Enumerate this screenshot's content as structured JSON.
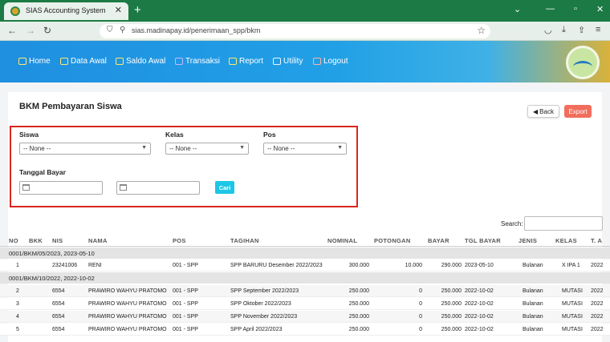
{
  "browser": {
    "tab_title": "SIAS Accounting System",
    "url": "sias.madinapay.id/penerimaan_spp/bkm"
  },
  "nav": {
    "items": [
      {
        "label": "Home",
        "icon": "home-icon"
      },
      {
        "label": "Data Awal",
        "icon": "monitor-icon"
      },
      {
        "label": "Saldo Awal",
        "icon": "scale-icon"
      },
      {
        "label": "Transaksi",
        "icon": "cart-icon"
      },
      {
        "label": "Report",
        "icon": "monitor-icon"
      },
      {
        "label": "Utility",
        "icon": "tools-icon"
      },
      {
        "label": "Logout",
        "icon": "logout-icon"
      }
    ]
  },
  "page": {
    "title": "BKM Pembayaran Siswa",
    "back_label": "Back",
    "export_label": "Export"
  },
  "filters": {
    "siswa_label": "Siswa",
    "siswa_value": "-- None --",
    "kelas_label": "Kelas",
    "kelas_value": "-- None --",
    "pos_label": "Pos",
    "pos_value": "-- None --",
    "tanggal_label": "Tanggal Bayar",
    "cari_label": "Cari"
  },
  "search": {
    "label": "Search:"
  },
  "table": {
    "headers": [
      "NO",
      "BKK",
      "NIS",
      "NAMA",
      "POS",
      "TAGIHAN",
      "NOMINAL",
      "POTONGAN",
      "BAYAR",
      "TGL BAYAR",
      "JENIS",
      "KELAS",
      "T. A"
    ],
    "groups": [
      {
        "label": "0001/BKM/05/2023, 2023-05-10",
        "rows": [
          [
            "1",
            "",
            "23241006",
            "RENI",
            "001 - SPP",
            "SPP BARURU Desember 2022/2023",
            "300.000",
            "10.000",
            "290.000",
            "2023-05-10",
            "Bulanan",
            "X IPA 1",
            "2022"
          ]
        ]
      },
      {
        "label": "0001/BKM/10/2022, 2022-10-02",
        "rows": [
          [
            "2",
            "",
            "6554",
            "PRAWIRO WAHYU PRATOMO",
            "001 - SPP",
            "SPP September 2022/2023",
            "250.000",
            "0",
            "250.000",
            "2022-10-02",
            "Bulanan",
            "MUTASI",
            "2022"
          ],
          [
            "3",
            "",
            "6554",
            "PRAWIRO WAHYU PRATOMO",
            "001 - SPP",
            "SPP Oktober 2022/2023",
            "250.000",
            "0",
            "250.000",
            "2022-10-02",
            "Bulanan",
            "MUTASI",
            "2022"
          ],
          [
            "4",
            "",
            "6554",
            "PRAWIRO WAHYU PRATOMO",
            "001 - SPP",
            "SPP November 2022/2023",
            "250.000",
            "0",
            "250.000",
            "2022-10-02",
            "Bulanan",
            "MUTASI",
            "2022"
          ],
          [
            "5",
            "",
            "6554",
            "PRAWIRO WAHYU PRATOMO",
            "001 - SPP",
            "SPP April 2022/2023",
            "250.000",
            "0",
            "250.000",
            "2022-10-02",
            "Bulanan",
            "MUTASI",
            "2022"
          ]
        ]
      }
    ]
  }
}
